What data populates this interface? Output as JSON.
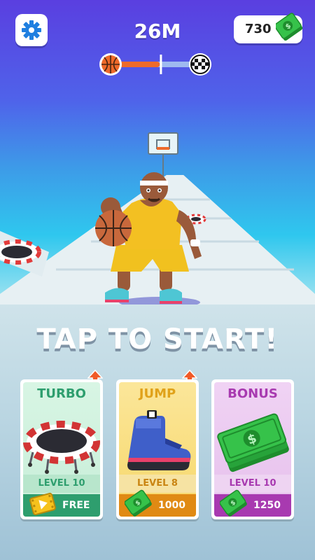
{
  "hud": {
    "settings_icon": "gear-icon",
    "distance": "26M",
    "progress_fraction": 0.55,
    "money": "730",
    "money_icon": "cash-icon"
  },
  "prompt": "TAP TO START!",
  "upgrades": [
    {
      "title": "TURBO",
      "art_icon": "trampoline-icon",
      "level": "LEVEL 10",
      "cost_icon": "video-ad-icon",
      "cost": "FREE",
      "arrow": true
    },
    {
      "title": "JUMP",
      "art_icon": "sneaker-icon",
      "level": "LEVEL 8",
      "cost_icon": "cash-icon",
      "cost": "1000",
      "arrow": true
    },
    {
      "title": "BONUS",
      "art_icon": "cash-stack-icon",
      "level": "LEVEL 10",
      "cost_icon": "cash-icon",
      "cost": "1250",
      "arrow": false
    }
  ],
  "colors": {
    "turbo": "#2e9e6e",
    "jump": "#e0a21a",
    "bonus": "#a83ab0",
    "arrow": "#f05a28"
  }
}
